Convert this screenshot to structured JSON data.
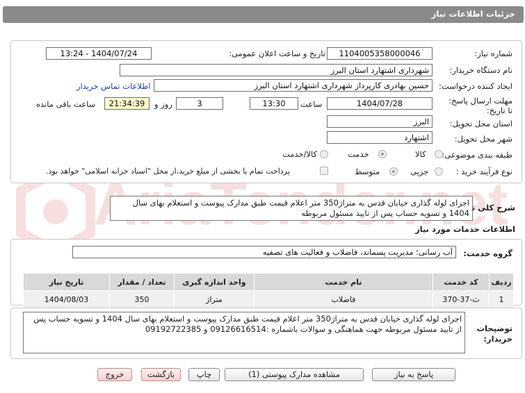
{
  "header": {
    "title": "جزئیات اطلاعات نیاز"
  },
  "form": {
    "need_number_label": "شماره نیاز:",
    "need_number": "1104005358000046",
    "announce_label": "تاریخ و ساعت اعلان عمومی:",
    "announce_value": "1404/07/24 - 13:24",
    "buyer_org_label": "نام دستگاه خریدار:",
    "buyer_org": "شهرداری اشتهارد استان البرز",
    "creator_label": "ایجاد کننده درخواست:",
    "creator": "حسین بهادری کارپرداز شهرداری اشتهارد استان البرز",
    "contact_link": "اطلاعات تماس خریدار",
    "deadline_label": "مهلت ارسال پاسخ: تا تاریخ:",
    "deadline_date": "1404/07/28",
    "time_label": "ساعت",
    "deadline_time": "13:30",
    "days_value": "3",
    "days_label": "روز و",
    "remaining_time": "21:34:39",
    "remaining_label": "ساعت باقی مانده",
    "province_label": "استان محل تحویل:",
    "province": "البرز",
    "city_label": "شهر محل تحویل:",
    "city": "اشتهارد",
    "category_label": "طبقه بندی موضوعی:",
    "category_options": [
      "کالا",
      "خدمت",
      "کالا/خدمت"
    ],
    "category_selected": "خدمت",
    "process_label": "نوع فرآیند خرید :",
    "process_options": [
      "جزیی",
      "متوسط"
    ],
    "process_selected": "متوسط",
    "payment_note": "پرداخت تمام یا بخشی از مبلغ خرید،از محل \"اسناد خزانه اسلامی\" خواهد بود."
  },
  "description": {
    "label": "شرح کلی نیاز:",
    "text": "اجرای لوله گذاری خیابان قدس به متراژ350 متر اعلام قیمت طبق مدارک پیوست و استعلام بهای سال 1404 و تسویه حساب پس از تایید مسئول مربوطه"
  },
  "services": {
    "title": "اطلاعات خدمات مورد نیاز",
    "group_label": "گروه خدمت:",
    "group_value": "آب رسانی؛ مدیریت پسماند، فاضلاب و فعالیت های تصفیه",
    "columns": [
      "ردیف",
      "کد خدمت",
      "نام خدمت",
      "واحد اندازه گیری",
      "تعداد / مقدار",
      "تاریخ نیاز"
    ],
    "rows": [
      [
        "1",
        "ث-37-370",
        "فاضلاب",
        "متراژ",
        "350",
        "1404/08/03"
      ]
    ]
  },
  "buyer_notes": {
    "label": "توضیحات خریدار:",
    "text": "اجرای لوله گذاری خیابان قدس به متراژ350 متر اعلام قیمت طبق مدارک پیوست و استعلام بهای سال 1404 و تسویه حساب پس از تایید مسئول مربوطه جهت هماهنگی و سوالات باشماره :09126616514 و 09192722385"
  },
  "buttons": {
    "respond": "پاسخ به نیاز",
    "attachments": "مشاهده مدارک پیوستی (1)",
    "print": "چاپ",
    "back": "بازگشت",
    "exit": "خروج"
  },
  "watermark": "AriaTender.net",
  "colors": {
    "header_bg": "#8a8a8a",
    "link": "#1a3fb5",
    "time_bg": "#fffacd"
  }
}
